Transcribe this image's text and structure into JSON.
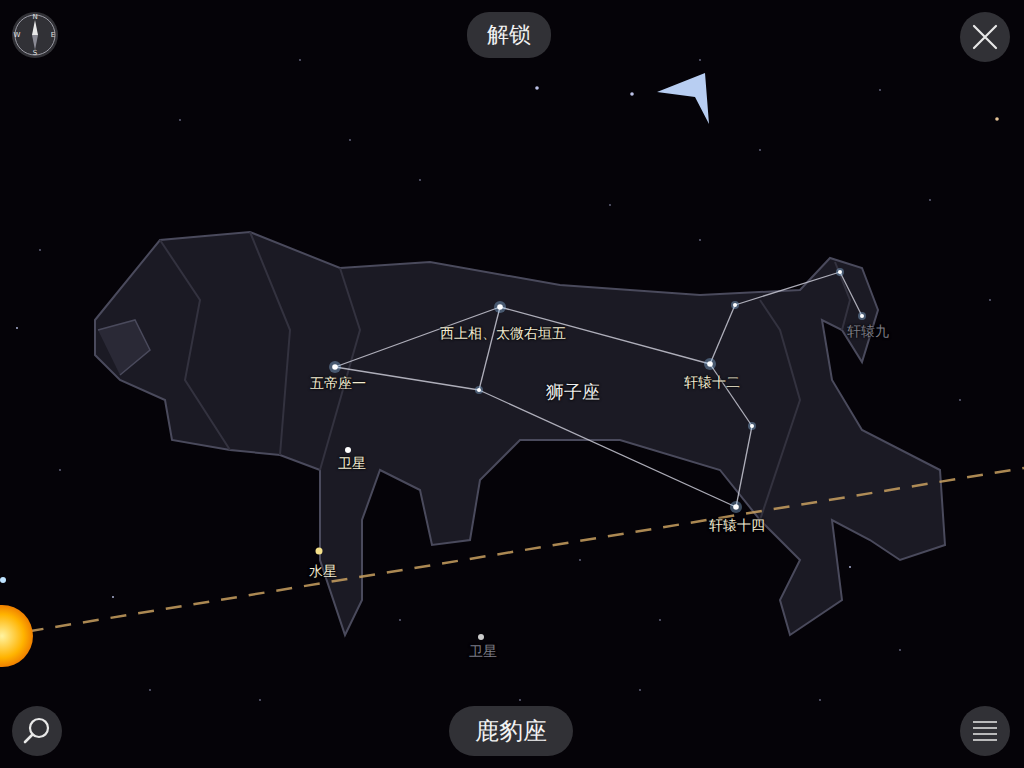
{
  "top_bar": {
    "unlock_button": "解锁"
  },
  "compass": {
    "labels": [
      "N",
      "E",
      "S",
      "W"
    ]
  },
  "constellation": {
    "name": "狮子座"
  },
  "stars": [
    {
      "label": "五帝座一",
      "dim": false
    },
    {
      "label": "西上相、太微右垣五",
      "dim": false
    },
    {
      "label": "轩辕十二",
      "dim": false
    },
    {
      "label": "轩辕十四",
      "dim": false
    },
    {
      "label": "轩辕九",
      "dim": true
    }
  ],
  "objects": [
    {
      "label": "卫星",
      "kind": "satellite",
      "dim": false
    },
    {
      "label": "水星",
      "kind": "planet",
      "dim": false
    },
    {
      "label": "卫星",
      "kind": "satellite",
      "dim": true
    }
  ],
  "bottom_bar": {
    "current_constellation": "鹿豹座"
  }
}
